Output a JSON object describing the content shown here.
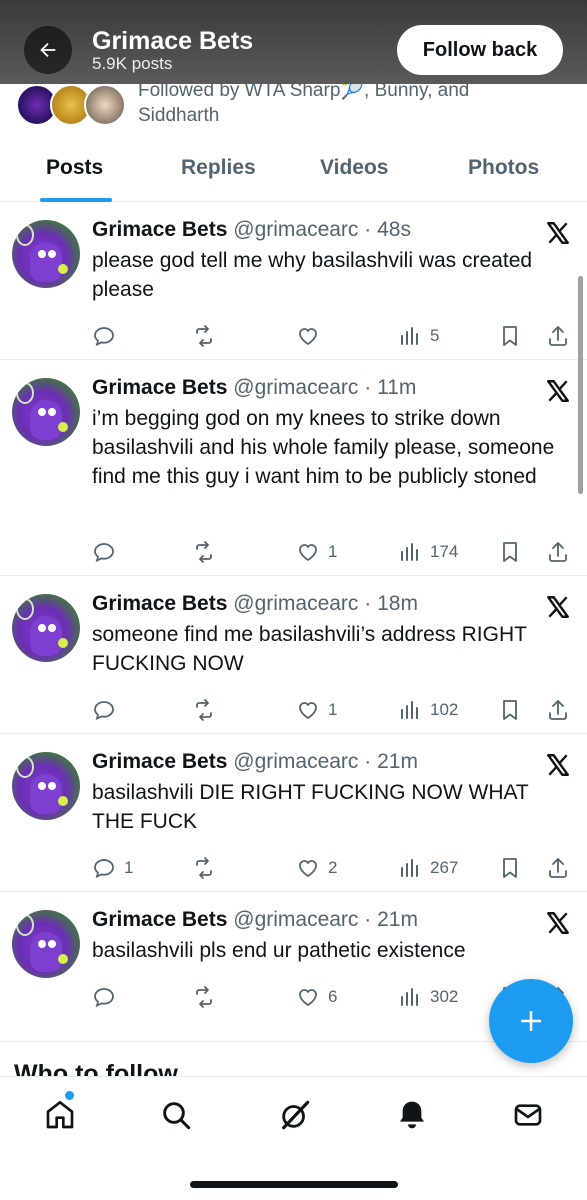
{
  "header": {
    "title": "Grimace Bets",
    "posts_count": "5.9K posts",
    "follow_back_label": "Follow back"
  },
  "followed_by": {
    "line1": "Followed by WTA Sharp🎾, Bunny, and",
    "line2": "Siddharth",
    "avatars": [
      "wta-sharp-avatar",
      "bunny-avatar",
      "siddharth-avatar"
    ]
  },
  "tabs": [
    {
      "label": "Posts",
      "active": true
    },
    {
      "label": "Replies",
      "active": false
    },
    {
      "label": "Videos",
      "active": false
    },
    {
      "label": "Photos",
      "active": false
    }
  ],
  "posts": [
    {
      "name": "Grimace Bets",
      "handle": "@grimacearc",
      "time": "48s",
      "text": "please god tell me why basilashvili was created please",
      "replies": "",
      "reposts": "",
      "likes": "",
      "views": "5"
    },
    {
      "name": "Grimace Bets",
      "handle": "@grimacearc",
      "time": "11m",
      "text": "i’m begging god on my knees to strike down basilashvili and his whole family please, someone find me this guy i want him to be publicly stoned",
      "replies": "",
      "reposts": "",
      "likes": "1",
      "views": "174"
    },
    {
      "name": "Grimace Bets",
      "handle": "@grimacearc",
      "time": "18m",
      "text": "someone find me basilashvili’s address RIGHT FUCKING NOW",
      "replies": "",
      "reposts": "",
      "likes": "1",
      "views": "102"
    },
    {
      "name": "Grimace Bets",
      "handle": "@grimacearc",
      "time": "21m",
      "text": "basilashvili DIE RIGHT FUCKING NOW WHAT THE FUCK",
      "replies": "1",
      "reposts": "",
      "likes": "2",
      "views": "267"
    },
    {
      "name": "Grimace Bets",
      "handle": "@grimacearc",
      "time": "21m",
      "text": "basilashvili pls end ur pathetic existence",
      "replies": "",
      "reposts": "",
      "likes": "6",
      "views": "302"
    }
  ],
  "section": {
    "who_to_follow": "Who to follow"
  },
  "bottom_nav": [
    "home-icon",
    "search-icon",
    "grok-icon",
    "notifications-icon",
    "messages-icon"
  ],
  "colors": {
    "accent": "#1d9bf0",
    "text": "#0f1419",
    "muted": "#536471"
  }
}
